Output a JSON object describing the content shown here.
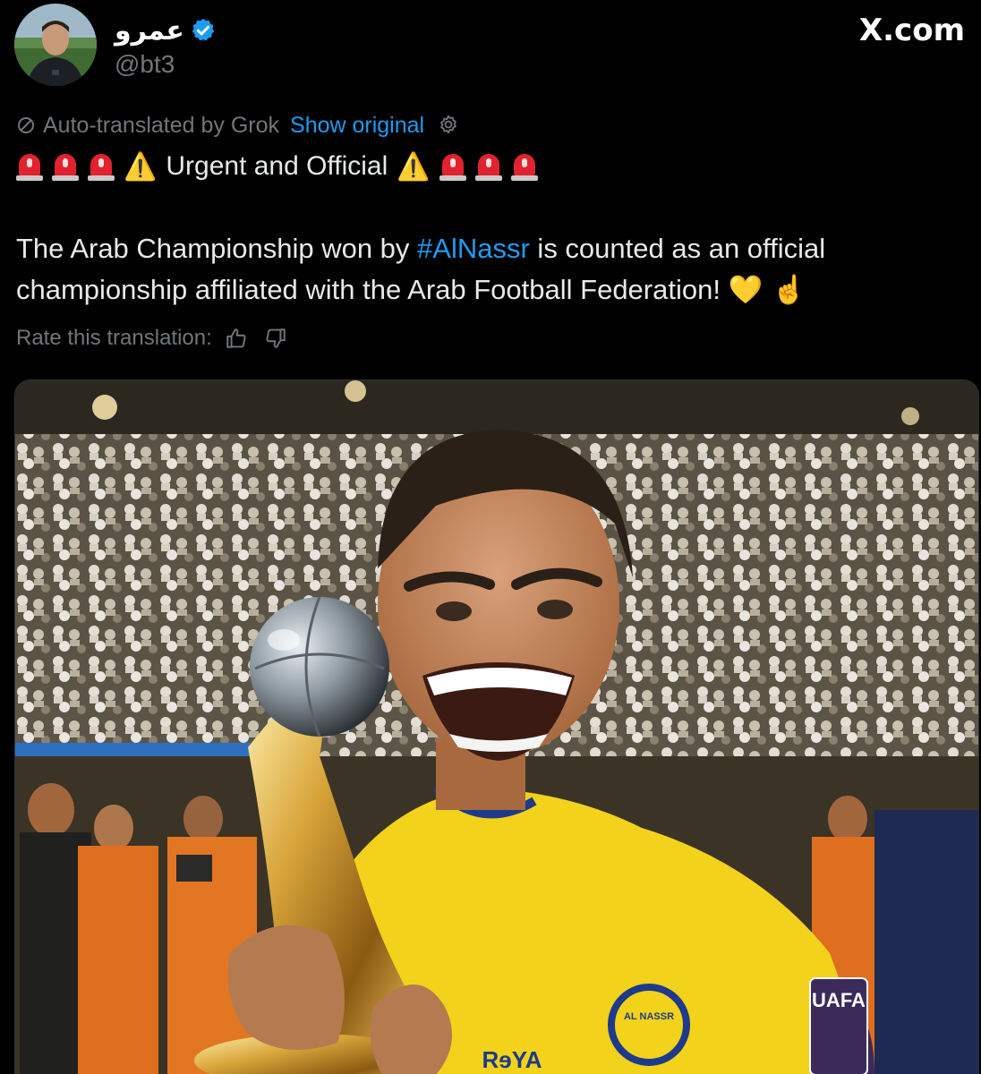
{
  "author": {
    "display_name": "عمرو",
    "handle": "@bt3",
    "verified": true,
    "avatar": "avatar-photo"
  },
  "site_label": "X.com",
  "translation": {
    "notice": "Auto-translated by Grok",
    "show_original": "Show original",
    "rate_label": "Rate this translation:"
  },
  "post": {
    "headline": "Urgent and Official",
    "warning_glyph": "⚠️",
    "text_before_hashtag": "The Arab Championship won by ",
    "hashtag": "#AlNassr",
    "text_after_hashtag": " is counted as an official championship affiliated with the Arab Football Federation! ",
    "trailing_emojis": "💛 ☝️"
  },
  "media": {
    "badge_text": "UAFA",
    "crest_text": "AL NASSR",
    "sponsor_text": "RɘYA"
  },
  "colors": {
    "background": "#000000",
    "link": "#1d9bf0",
    "secondary_text": "#71767b",
    "verified_badge": "#1d9bf0",
    "siren_red": "#e0232f",
    "jersey_yellow": "#f2d21a"
  },
  "icons": [
    "verified-badge-icon",
    "no-translate-icon",
    "gear-icon",
    "thumbs-up-icon",
    "thumbs-down-icon",
    "siren-icon",
    "warning-icon"
  ]
}
